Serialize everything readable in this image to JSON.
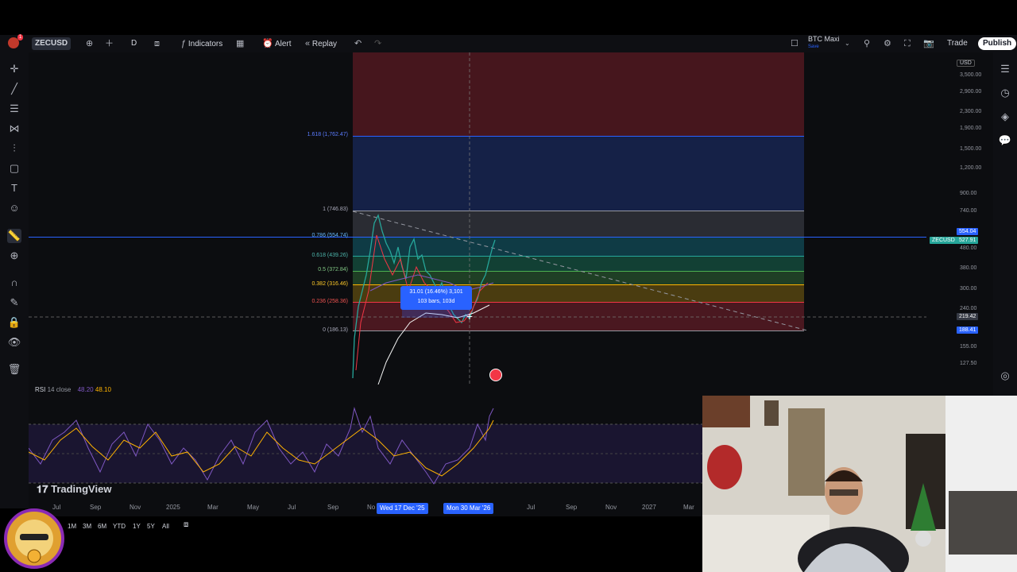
{
  "toolbar": {
    "symbol": "ZECUSD",
    "interval": "D",
    "indicators_label": "Indicators",
    "alert_label": "Alert",
    "replay_label": "Replay",
    "layout_name": "BTC Maxi",
    "layout_sub": "Save",
    "trade_label": "Trade",
    "publish_label": "Publish",
    "avatar_badge": "1"
  },
  "price_axis": {
    "currency": "USD",
    "ticks": [
      "3,500.00",
      "2,900.00",
      "2,300.00",
      "1,900.00",
      "1,500.00",
      "1,200.00",
      "900.00",
      "740.00",
      "480.00",
      "380.00",
      "300.00",
      "240.00",
      "155.00",
      "127.50"
    ],
    "tags": {
      "upper_price": "554.04",
      "symbol": "ZECUSD",
      "last_price": "527.91",
      "crosshair_price": "219.42",
      "lower_price": "188.41"
    }
  },
  "fib": {
    "levels": [
      {
        "label": "1.618 (1,762.47)",
        "color": "#2962ff"
      },
      {
        "label": "1 (746.83)",
        "color": "#9598a1"
      },
      {
        "label": "0.786 (554.74)",
        "color": "#2196f3"
      },
      {
        "label": "0.618 (439.26)",
        "color": "#26a69a"
      },
      {
        "label": "0.5 (372.84)",
        "color": "#4caf50"
      },
      {
        "label": "0.382 (316.46)",
        "color": "#ffb300"
      },
      {
        "label": "0.236 (258.36)",
        "color": "#f23645"
      },
      {
        "label": "0 (186.13)",
        "color": "#9598a1"
      }
    ]
  },
  "measure_tooltip": {
    "line1": "31.01 (16.46%) 3,101",
    "line2": "103 bars, 103d"
  },
  "rsi": {
    "title": "RSI",
    "params": "14 close",
    "value1": "48.20",
    "value2": "48.10"
  },
  "time_axis": {
    "ticks": [
      "Jul",
      "Sep",
      "Nov",
      "2025",
      "Mar",
      "May",
      "Jul",
      "Sep",
      "No",
      "Jul",
      "Sep",
      "Nov",
      "2027",
      "Mar"
    ],
    "cursor_start": "Wed 17 Dec '25",
    "cursor_end": "Mon 30 Mar '26"
  },
  "watermark": "TradingView",
  "ranges": [
    "1M",
    "3M",
    "6M",
    "YTD",
    "1Y",
    "5Y",
    "All"
  ],
  "colors": {
    "accent": "#2962ff",
    "up": "#26a69a",
    "down": "#f23645",
    "rsi_line": "#7e57c2",
    "rsi_signal": "#ffb300"
  }
}
